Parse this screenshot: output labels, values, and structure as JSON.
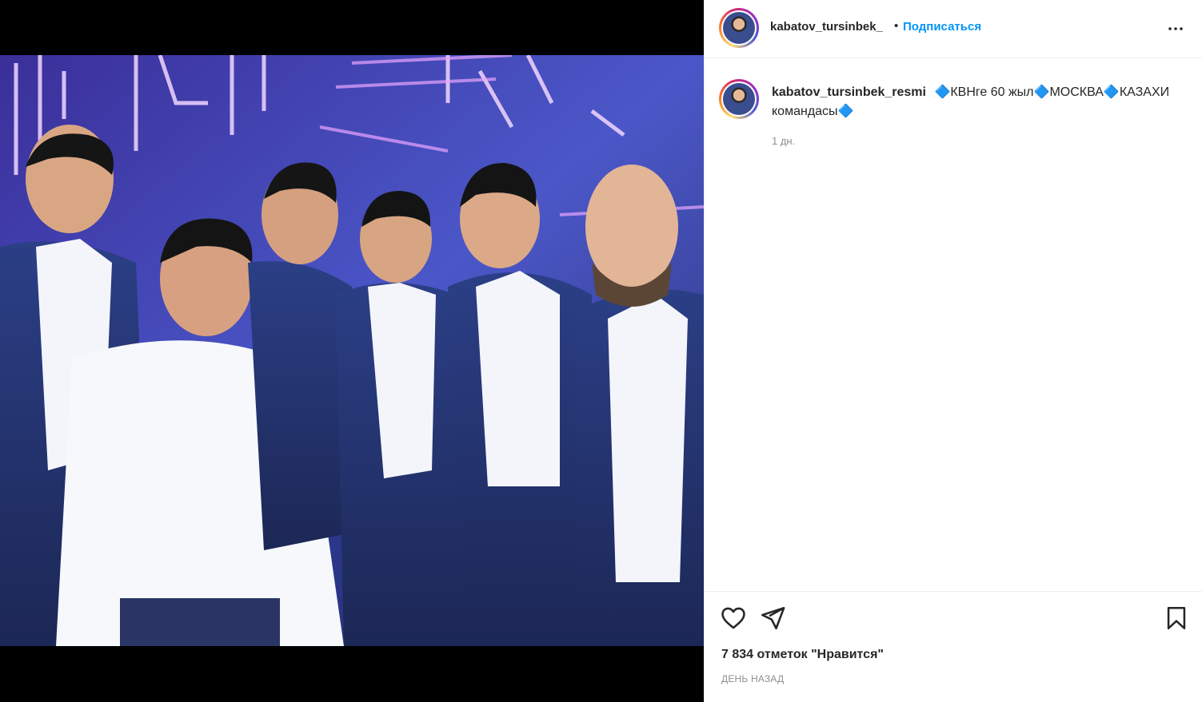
{
  "post": {
    "username": "kabatov_tursinbek_",
    "header_username_display": "kabatov_tursinbek_",
    "dot": "•",
    "follow_label": "Подписаться",
    "more_icon": "more-horizontal-icon",
    "caption": {
      "username": "kabatov_tursinbek_resmi",
      "text": "🔷КВНге 60 жыл🔷МОСКВА🔷КАЗАХИ командасы🔷",
      "time": "1 дн."
    },
    "actions": {
      "like_icon": "heart-icon",
      "share_icon": "send-icon",
      "save_icon": "bookmark-icon"
    },
    "likes": "7 834 отметок \"Нравится\"",
    "posted": "ДЕНЬ НАЗАД"
  },
  "colors": {
    "accent": "#0095f6",
    "text": "#262626",
    "muted": "#8e8e8e",
    "border": "#efefef"
  }
}
